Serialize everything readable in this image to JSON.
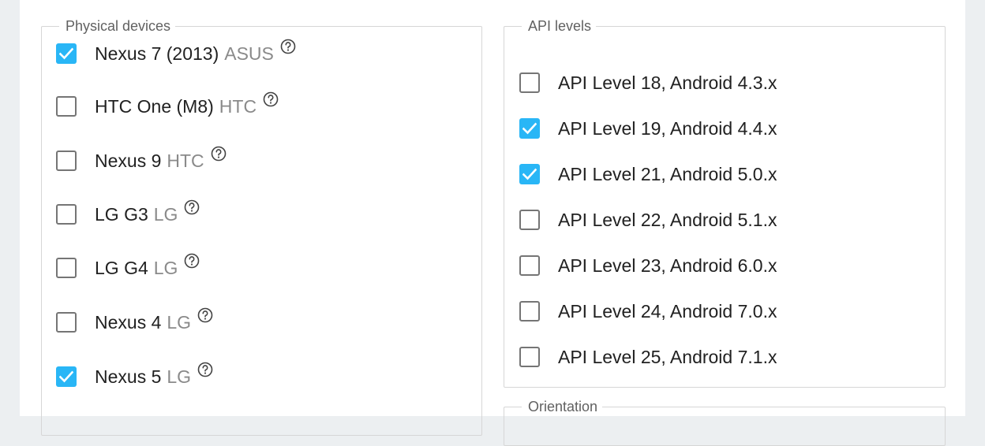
{
  "physical_devices": {
    "legend": "Physical devices",
    "items": [
      {
        "name": "Nexus 7 (2013)",
        "maker": "ASUS",
        "checked": true
      },
      {
        "name": "HTC One (M8)",
        "maker": "HTC",
        "checked": false
      },
      {
        "name": "Nexus 9",
        "maker": "HTC",
        "checked": false
      },
      {
        "name": "LG G3",
        "maker": "LG",
        "checked": false
      },
      {
        "name": "LG G4",
        "maker": "LG",
        "checked": false
      },
      {
        "name": "Nexus 4",
        "maker": "LG",
        "checked": false
      },
      {
        "name": "Nexus 5",
        "maker": "LG",
        "checked": true
      }
    ]
  },
  "api_levels": {
    "legend": "API levels",
    "items": [
      {
        "label": "API Level 18, Android 4.3.x",
        "checked": false
      },
      {
        "label": "API Level 19, Android 4.4.x",
        "checked": true
      },
      {
        "label": "API Level 21, Android 5.0.x",
        "checked": true
      },
      {
        "label": "API Level 22, Android 5.1.x",
        "checked": false
      },
      {
        "label": "API Level 23, Android 6.0.x",
        "checked": false
      },
      {
        "label": "API Level 24, Android 7.0.x",
        "checked": false
      },
      {
        "label": "API Level 25, Android 7.1.x",
        "checked": false
      }
    ]
  },
  "orientation": {
    "legend": "Orientation"
  },
  "icons": {
    "checkbox_checked": "check-icon",
    "device_help": "help-circle-icon"
  },
  "colors": {
    "checkbox_checked": "#29b6f6",
    "checkbox_border": "#757575",
    "maker_text": "#8a8a8a",
    "legend_text": "#616161",
    "page_background": "#eceff1"
  }
}
